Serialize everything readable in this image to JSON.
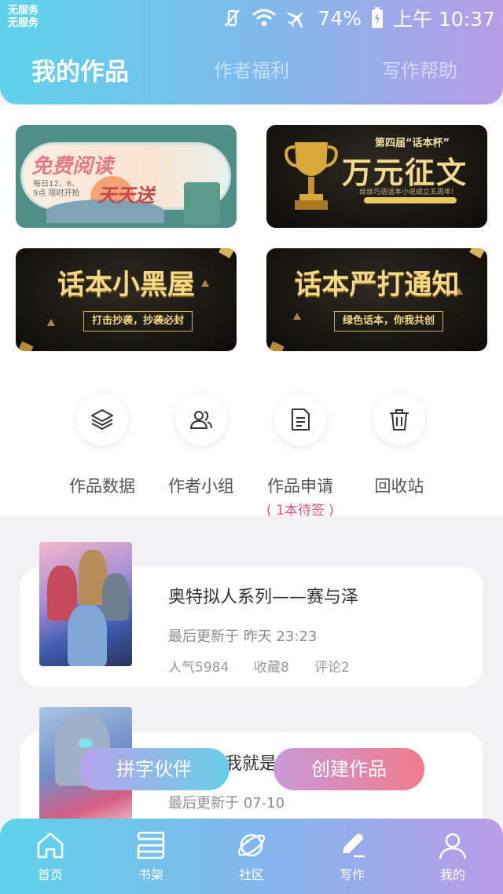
{
  "status_bar": {
    "carrier_line1": "无服务",
    "carrier_line2": "无服务",
    "battery": "74%",
    "time": "上午 10:37"
  },
  "tabs": [
    {
      "label": "我的作品",
      "active": true
    },
    {
      "label": "作者福利",
      "active": false
    },
    {
      "label": "写作帮助",
      "active": false
    }
  ],
  "banners": {
    "free_read": {
      "line1": "免费阅读",
      "line2": "天天送",
      "note": "每日12、6、9点 限时开抢"
    },
    "contest": {
      "header": "第四届“话本杯”",
      "title": "万元征文",
      "sub": "丝丝巧语话本小说成立五周年!"
    },
    "blackroom": {
      "title": "话本小黑屋",
      "label": "打击抄袭，抄袭必封"
    },
    "notice": {
      "title": "话本严打通知",
      "label": "绿色话本，你我共创"
    }
  },
  "quick_actions": [
    {
      "label": "作品数据",
      "icon": "layers-icon",
      "note": ""
    },
    {
      "label": "作者小组",
      "icon": "group-icon",
      "note": ""
    },
    {
      "label": "作品申请",
      "icon": "document-icon",
      "note": "( 1本待签 )"
    },
    {
      "label": "回收站",
      "icon": "trash-icon",
      "note": ""
    }
  ],
  "works": [
    {
      "title": "奥特拟人系列——赛与泽",
      "updated": "最后更新于 昨天 23:23",
      "popularity": "人气5984",
      "favorites": "收藏8",
      "comments": "评论2"
    },
    {
      "title": "我就是",
      "updated": "最后更新于 07-10"
    }
  ],
  "floating_buttons": {
    "partner": "拼字伙伴",
    "create": "创建作品"
  },
  "bottom_nav": [
    {
      "label": "首页",
      "icon": "home-icon",
      "active": false
    },
    {
      "label": "书架",
      "icon": "bookshelf-icon",
      "active": false
    },
    {
      "label": "社区",
      "icon": "planet-icon",
      "active": false
    },
    {
      "label": "写作",
      "icon": "pen-icon",
      "active": true
    },
    {
      "label": "我的",
      "icon": "person-icon",
      "active": false
    }
  ]
}
